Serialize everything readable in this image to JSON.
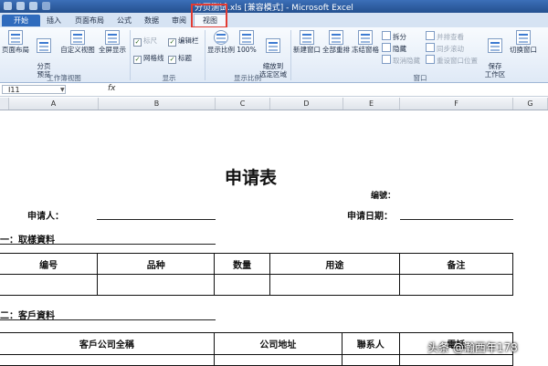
{
  "window": {
    "title": "分页测试.xls  [兼容模式] - Microsoft Excel"
  },
  "ribbon_tabs": [
    {
      "label": "开始"
    },
    {
      "label": "插入"
    },
    {
      "label": "页面布局"
    },
    {
      "label": "公式"
    },
    {
      "label": "数据"
    },
    {
      "label": "审阅"
    },
    {
      "label": "视图",
      "active": true
    }
  ],
  "ribbon": {
    "workbook_views": {
      "page_layout": "页面布局",
      "page_break_preview": "分页\n预览",
      "custom_views": "自定义视图",
      "full_screen": "全屏显示",
      "group_label": "工作簿视图"
    },
    "show": {
      "ruler": "标尺",
      "formula_bar": "编辑栏",
      "gridlines": "网格线",
      "headings": "标题",
      "group_label": "显示",
      "ruler_checked": true,
      "formula_bar_checked": true,
      "gridlines_checked": true,
      "headings_checked": true
    },
    "zoom": {
      "zoom": "显示比例",
      "zoom_100": "100%",
      "zoom_to_selection": "缩放到\n选定区域",
      "group_label": "显示比例"
    },
    "window": {
      "new_window": "新建窗口",
      "arrange_all": "全部重排",
      "freeze_panes": "冻结窗格",
      "split": "拆分",
      "hide": "隐藏",
      "unhide": "取消隐藏",
      "view_side_by_side": "并排查看",
      "synchronous_scrolling": "同步滚动",
      "reset_window_position": "重设窗口位置",
      "save_workspace": "保存\n工作区",
      "switch_windows": "切换窗口",
      "group_label": "窗口"
    }
  },
  "formula_bar": {
    "name_box": "I11",
    "fx": "fx",
    "value": ""
  },
  "columns": [
    "A",
    "B",
    "C",
    "D",
    "E",
    "F",
    "G"
  ],
  "sheet": {
    "title": "申请表",
    "number_label": "编號：",
    "applicant_label": "申请人：",
    "apply_date_label": "申请日期：",
    "section1": "一：取樣資料",
    "table1_headers": [
      "编号",
      "品种",
      "数量",
      "用途",
      "备注"
    ],
    "section2": "二：客戶資料",
    "table2_headers": [
      "客戶公司全稱",
      "公司地址",
      "聯系人",
      "電話"
    ]
  },
  "watermark": "头条 @瀚西年178"
}
